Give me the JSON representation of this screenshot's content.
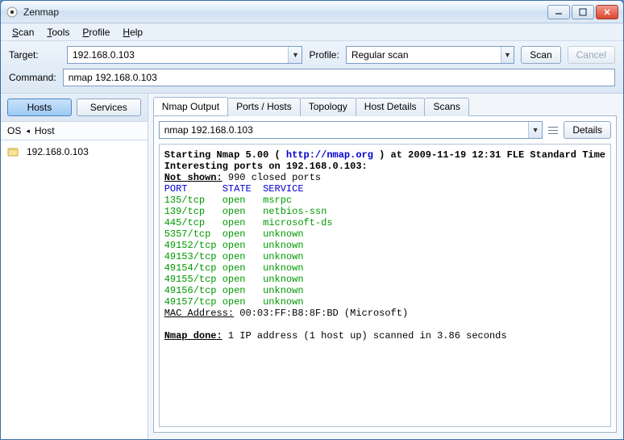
{
  "window": {
    "title": "Zenmap"
  },
  "menu": {
    "scan": "Scan",
    "tools": "Tools",
    "profile": "Profile",
    "help": "Help"
  },
  "toolbar": {
    "target_label": "Target:",
    "target_value": "192.168.0.103",
    "profile_label": "Profile:",
    "profile_value": "Regular scan",
    "scan_btn": "Scan",
    "cancel_btn": "Cancel"
  },
  "command": {
    "label": "Command:",
    "value": "nmap 192.168.0.103"
  },
  "sidebar": {
    "hosts_btn": "Hosts",
    "services_btn": "Services",
    "col_os": "OS",
    "col_host": "Host",
    "hosts": [
      {
        "ip": "192.168.0.103"
      }
    ]
  },
  "tabs": {
    "output": "Nmap Output",
    "ports": "Ports / Hosts",
    "topology": "Topology",
    "hostdetails": "Host Details",
    "scans": "Scans"
  },
  "output_top": {
    "command": "nmap 192.168.0.103",
    "details_btn": "Details"
  },
  "output": {
    "line1a": "Starting Nmap 5.00 ( ",
    "line1_url": "http://nmap.org",
    "line1b": " ) at 2009-11-19 12:31 FLE Standard Time",
    "line2": "Interesting ports on 192.168.0.103:",
    "not_shown_label": "Not shown:",
    "not_shown_rest": " 990 closed ports",
    "header": "PORT      STATE  SERVICE",
    "ports": [
      "135/tcp   open   msrpc",
      "139/tcp   open   netbios-ssn",
      "445/tcp   open   microsoft-ds",
      "5357/tcp  open   unknown",
      "49152/tcp open   unknown",
      "49153/tcp open   unknown",
      "49154/tcp open   unknown",
      "49155/tcp open   unknown",
      "49156/tcp open   unknown",
      "49157/tcp open   unknown"
    ],
    "mac_label": "MAC Address:",
    "mac_rest": " 00:03:FF:B8:8F:BD (Microsoft)",
    "done_label": "Nmap done:",
    "done_rest": " 1 IP address (1 host up) scanned in 3.86 seconds"
  }
}
